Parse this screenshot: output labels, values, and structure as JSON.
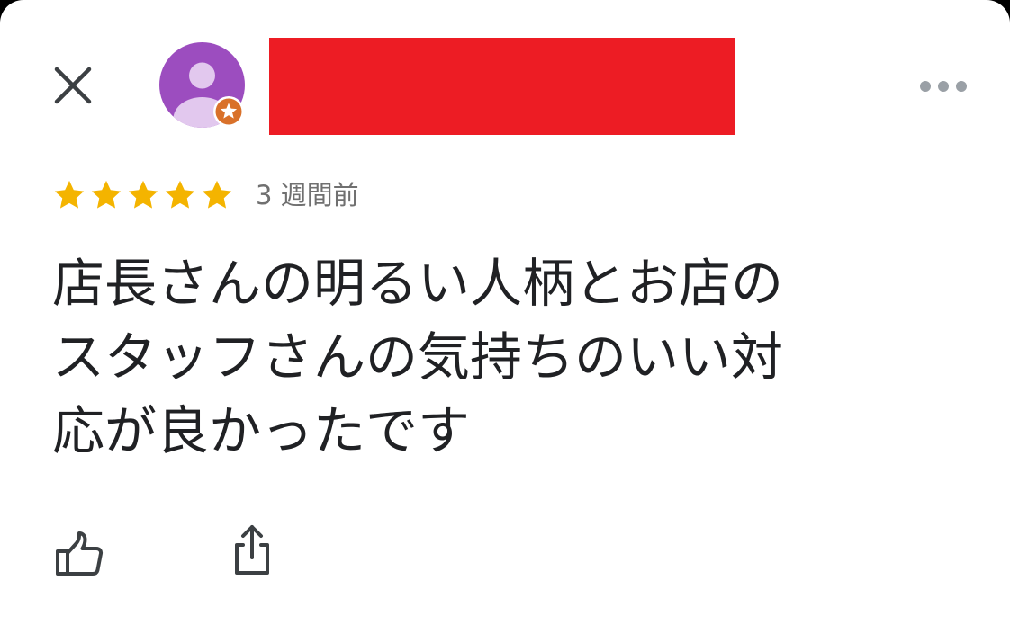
{
  "header": {
    "close_icon": "close-icon",
    "avatar_icon": "default-person-avatar",
    "badge_icon": "local-guide-star-badge",
    "name_redacted": true,
    "more_icon": "more-horizontal-icon"
  },
  "review": {
    "rating": 5,
    "max_rating": 5,
    "time_ago": "3 週間前",
    "text": "店長さんの明るい人柄とお店の\nスタッフさんの気持ちのいい対\n応が良かったです"
  },
  "actions": {
    "like_icon": "thumbs-up-icon",
    "share_icon": "share-icon"
  },
  "colors": {
    "star": "#F4B400",
    "avatar_bg": "#9C4DBF",
    "avatar_figure": "#E2C8EE",
    "badge": "#D9712A",
    "redaction": "#ED1C24",
    "text": "#202124",
    "subtext": "#707070",
    "icon": "#3C4043",
    "more": "#9AA0A6"
  }
}
